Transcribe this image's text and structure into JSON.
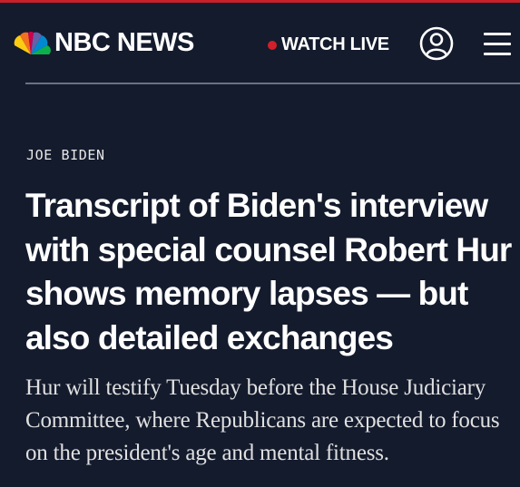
{
  "header": {
    "logo_text": "NBC NEWS",
    "watch_live_label": "WATCH LIVE",
    "account_icon": "account-circle-icon",
    "menu_icon": "hamburger-menu-icon"
  },
  "article": {
    "eyebrow": "JOE BIDEN",
    "headline": "Transcript of Biden's interview with special counsel Robert Hur shows memory lapses — but also detailed exchanges",
    "dek": "Hur will testify Tuesday before the House Judiciary Committee, where Republicans are expected to focus on the president's age and mental fitness."
  },
  "colors": {
    "background": "#141b2d",
    "live_dot": "#d0202a",
    "text": "#ffffff"
  }
}
